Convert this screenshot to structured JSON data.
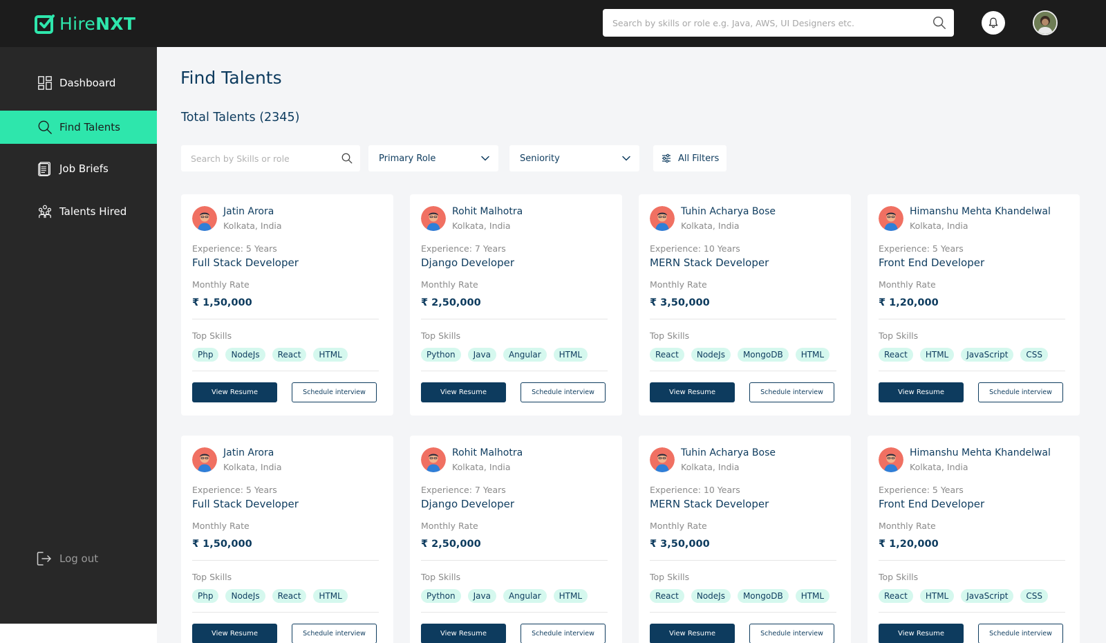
{
  "brand": {
    "name_part1": "Hire",
    "name_part2": "NXT",
    "accent": "#2ee6ac"
  },
  "header": {
    "search_placeholder": "Search by skills or role e.g. Java, AWS, UI Designers etc."
  },
  "sidebar": {
    "items": [
      {
        "label": "Dashboard",
        "icon": "dashboard-icon"
      },
      {
        "label": "Find Talents",
        "icon": "search-icon"
      },
      {
        "label": "Job Briefs",
        "icon": "document-icon"
      },
      {
        "label": "Talents Hired",
        "icon": "team-icon"
      }
    ],
    "logout_label": "Log out"
  },
  "main": {
    "title": "Find Talents",
    "total": "Total Talents (2345)",
    "filters": {
      "search_placeholder": "Search by Skills or role",
      "primary_role": "Primary Role",
      "seniority": "Seniority",
      "all_filters": "All Filters"
    },
    "card_labels": {
      "monthly_rate": "Monthly Rate",
      "top_skills": "Top Skills",
      "view_resume": "View Resume",
      "schedule_interview": "Schedule interview"
    },
    "talents": [
      {
        "name": "Jatin Arora",
        "location": "Kolkata, India",
        "experience": "Experience: 5 Years",
        "role": "Full Stack Developer",
        "rate": "₹ 1,50,000",
        "skills": [
          "Php",
          "NodeJs",
          "React",
          "HTML"
        ]
      },
      {
        "name": "Rohit Malhotra",
        "location": "Kolkata, India",
        "experience": "Experience: 7 Years",
        "role": "Django Developer",
        "rate": "₹ 2,50,000",
        "skills": [
          "Python",
          "Java",
          "Angular",
          "HTML"
        ]
      },
      {
        "name": "Tuhin Acharya Bose",
        "location": "Kolkata, India",
        "experience": "Experience: 10 Years",
        "role": "MERN Stack Developer",
        "rate": "₹ 3,50,000",
        "skills": [
          "React",
          "NodeJs",
          "MongoDB",
          "HTML"
        ]
      },
      {
        "name": "Himanshu Mehta Khandelwal",
        "location": "Kolkata, India",
        "experience": "Experience: 5 Years",
        "role": "Front End Developer",
        "rate": "₹ 1,20,000",
        "skills": [
          "React",
          "HTML",
          "JavaScript",
          "CSS"
        ]
      },
      {
        "name": "Jatin Arora",
        "location": "Kolkata, India",
        "experience": "Experience: 5 Years",
        "role": "Full Stack Developer",
        "rate": "₹ 1,50,000",
        "skills": [
          "Php",
          "NodeJs",
          "React",
          "HTML"
        ]
      },
      {
        "name": "Rohit Malhotra",
        "location": "Kolkata, India",
        "experience": "Experience: 7 Years",
        "role": "Django Developer",
        "rate": "₹ 2,50,000",
        "skills": [
          "Python",
          "Java",
          "Angular",
          "HTML"
        ]
      },
      {
        "name": "Tuhin Acharya Bose",
        "location": "Kolkata, India",
        "experience": "Experience: 10 Years",
        "role": "MERN Stack Developer",
        "rate": "₹ 3,50,000",
        "skills": [
          "React",
          "NodeJs",
          "MongoDB",
          "HTML"
        ]
      },
      {
        "name": "Himanshu Mehta Khandelwal",
        "location": "Kolkata, India",
        "experience": "Experience: 5 Years",
        "role": "Front End Developer",
        "rate": "₹ 1,20,000",
        "skills": [
          "React",
          "HTML",
          "JavaScript",
          "CSS"
        ]
      }
    ]
  }
}
